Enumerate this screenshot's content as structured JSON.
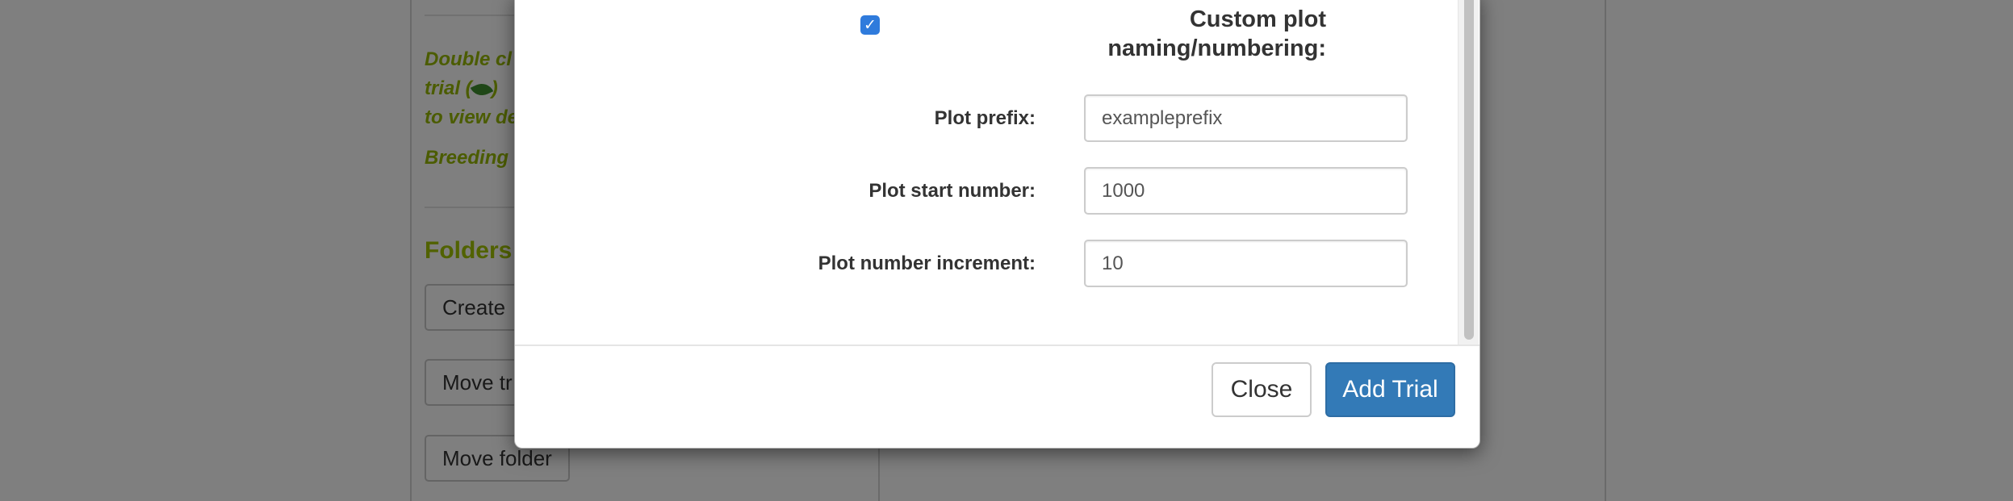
{
  "background": {
    "help_lines": [
      "Double cl",
      "trial (",
      ") ",
      "to view de"
    ],
    "breeding_text": "Breeding",
    "folders_title": "Folders",
    "buttons": {
      "create_label": "Create",
      "move_trial_label": "Move tr",
      "move_folder_label": "Move folder"
    }
  },
  "modal": {
    "custom_naming": {
      "label_line1": "Custom plot",
      "label_line2": "naming/numbering:",
      "checked": true,
      "check_glyph": "✓"
    },
    "fields": {
      "prefix": {
        "label": "Plot prefix:",
        "value": "exampleprefix"
      },
      "start": {
        "label": "Plot start number:",
        "value": "1000"
      },
      "increment": {
        "label": "Plot number increment:",
        "value": "10"
      }
    },
    "footer": {
      "close_label": "Close",
      "add_label": "Add Trial"
    }
  },
  "colors": {
    "primary": "#337ab7",
    "checkbox": "#2f7bdc",
    "help_text": "#96b800",
    "overlay": "rgba(0,0,0,0.5)"
  },
  "icons": {
    "leaf": "leaf-icon",
    "check": "check-icon"
  }
}
